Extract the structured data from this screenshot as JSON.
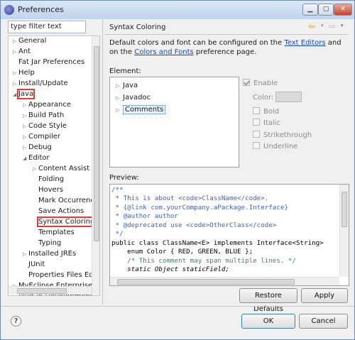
{
  "window": {
    "title": "Preferences"
  },
  "filter": {
    "value": "type filter text"
  },
  "tree": {
    "items": [
      {
        "label": "General",
        "expander": "▷"
      },
      {
        "label": "Ant",
        "expander": "▷"
      },
      {
        "label": "Fat Jar Preferences",
        "expander": ""
      },
      {
        "label": "Help",
        "expander": "▷"
      },
      {
        "label": "Install/Update",
        "expander": "▷"
      },
      {
        "label": "Java",
        "expander": "◢"
      },
      {
        "label": "Appearance",
        "expander": "▷"
      },
      {
        "label": "Build Path",
        "expander": "▷"
      },
      {
        "label": "Code Style",
        "expander": "▷"
      },
      {
        "label": "Compiler",
        "expander": "▷"
      },
      {
        "label": "Debug",
        "expander": "▷"
      },
      {
        "label": "Editor",
        "expander": "◢"
      },
      {
        "label": "Content Assist",
        "expander": "▷"
      },
      {
        "label": "Folding",
        "expander": ""
      },
      {
        "label": "Hovers",
        "expander": ""
      },
      {
        "label": "Mark Occurrences",
        "expander": ""
      },
      {
        "label": "Save Actions",
        "expander": ""
      },
      {
        "label": "Syntax Coloring",
        "expander": ""
      },
      {
        "label": "Templates",
        "expander": ""
      },
      {
        "label": "Typing",
        "expander": ""
      },
      {
        "label": "Installed JREs",
        "expander": "▷"
      },
      {
        "label": "JUnit",
        "expander": ""
      },
      {
        "label": "Properties Files Editor",
        "expander": ""
      },
      {
        "label": "MyEclipse Enterprise Workbench",
        "expander": "▷"
      },
      {
        "label": "Plug-in Development",
        "expander": "▷"
      }
    ]
  },
  "header": {
    "title": "Syntax Coloring",
    "nav_back": "⇦",
    "nav_forward": "▾",
    "nav_next": "⇨",
    "nav_menu": "▾"
  },
  "description": {
    "part1": "Default colors and font can be configured on the ",
    "link1": "Text Editors",
    "part2": " and on the ",
    "link2": "Colors and Fonts",
    "part3": " preference page."
  },
  "element": {
    "label": "Element:",
    "items": [
      {
        "label": "Java",
        "expander": "▷"
      },
      {
        "label": "Javadoc",
        "expander": "▷"
      },
      {
        "label": "Comments",
        "expander": "▷"
      }
    ]
  },
  "options": {
    "enable": "Enable",
    "color": "Color:",
    "bold": "Bold",
    "italic": "Italic",
    "strikethrough": "Strikethrough",
    "underline": "Underline"
  },
  "preview": {
    "label": "Preview:",
    "lines": [
      "/**",
      " * This is about <code>ClassName</code>.",
      " * {@link com.yourCompany.aPackage.Interface}",
      " * @author author",
      " * @deprecated use <code>OtherClass</code>",
      " */",
      "public class ClassName<E> implements Interface<String>",
      "    enum Color { RED, GREEN, BLUE };",
      "    /* This comment may span multiple lines. */",
      "    static Object staticField;"
    ]
  },
  "buttons": {
    "restore": "Restore Defaults",
    "apply": "Apply",
    "ok": "OK",
    "cancel": "Cancel"
  }
}
